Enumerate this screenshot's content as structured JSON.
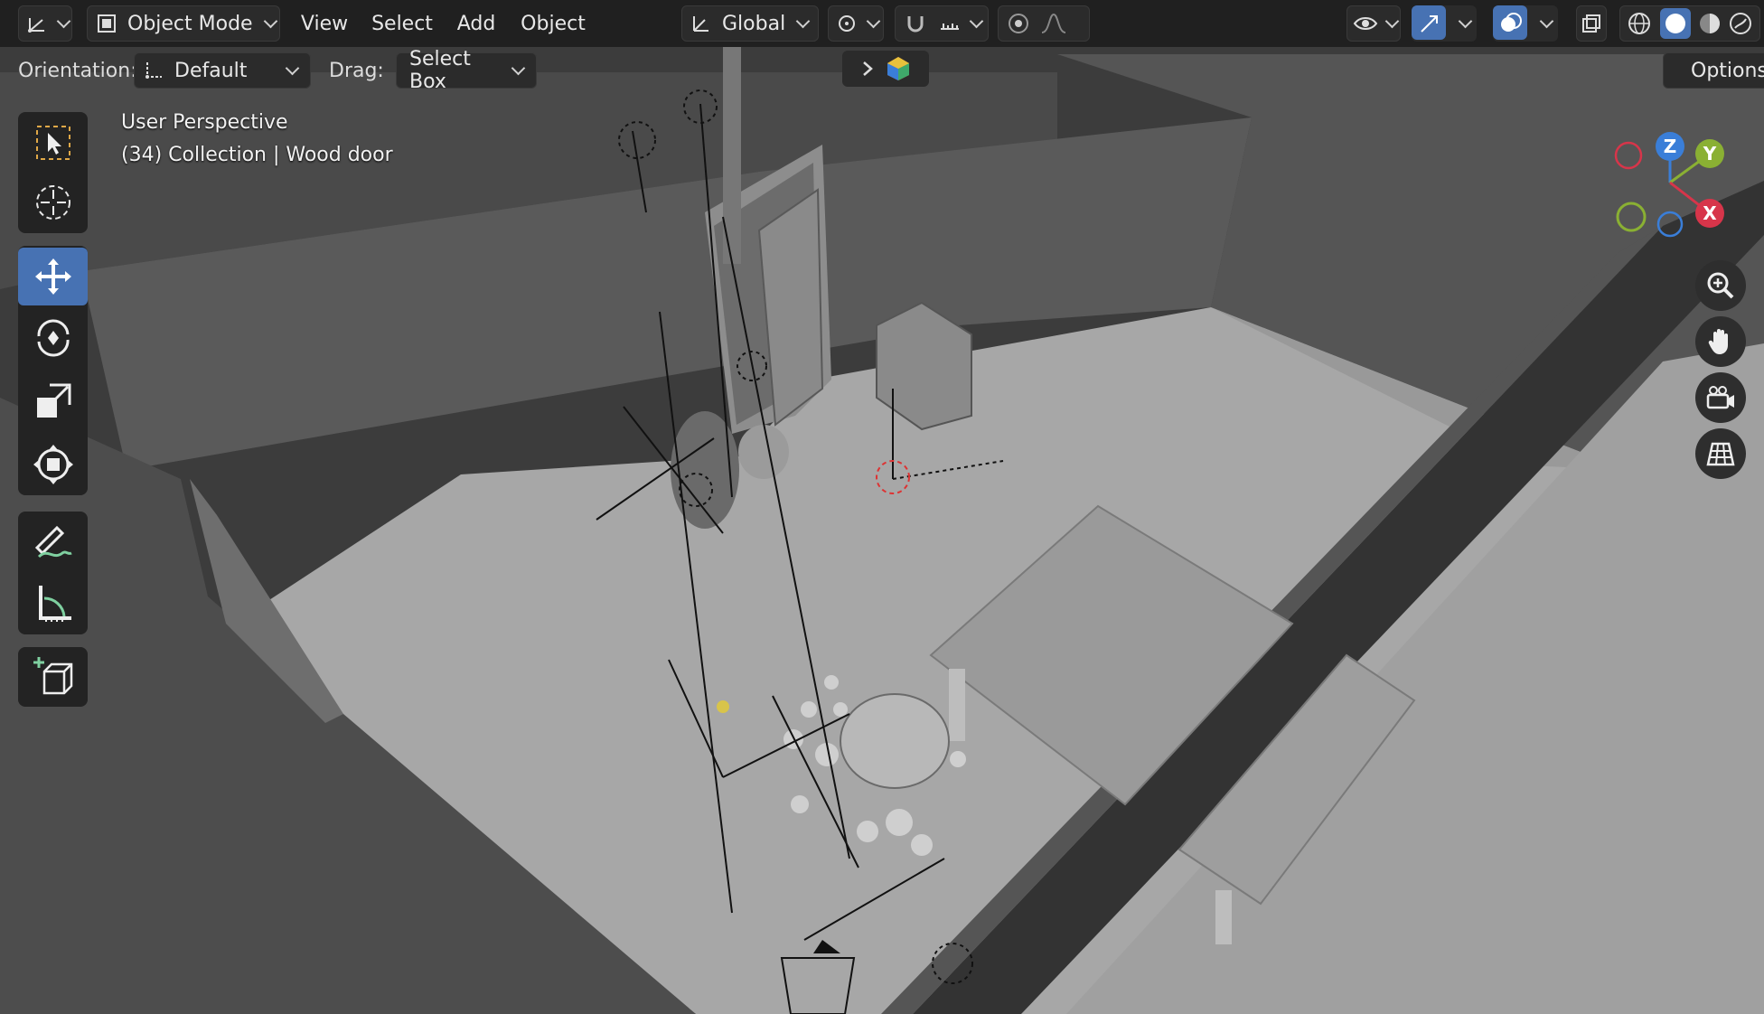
{
  "header": {
    "editor_type_icon": "axes-gizmo-icon",
    "mode": "Object Mode",
    "menus": [
      "View",
      "Select",
      "Add",
      "Object"
    ],
    "transform_orientation": "Global"
  },
  "tool_header": {
    "orientation_label": "Orientation:",
    "orientation_value": "Default",
    "drag_label": "Drag:",
    "drag_value": "Select Box",
    "options_label": "Options"
  },
  "viewport": {
    "perspective": "User Perspective",
    "collection_info": "(34) Collection | Wood door"
  },
  "gizmo": {
    "x": "X",
    "y": "Y",
    "z": "Z",
    "x_color": "#d7354a",
    "y_color": "#8ab033",
    "z_color": "#3a7ed8"
  },
  "colors": {
    "accent": "#4772b3",
    "header_bg": "#1c1c1c",
    "button_bg": "#2b2b2b"
  },
  "toolbar_tools": [
    {
      "name": "select-box-tool",
      "icon": "select-cursor-icon"
    },
    {
      "name": "cursor-tool",
      "icon": "crosshair-cursor-icon"
    },
    {
      "name": "move-tool",
      "icon": "move-arrows-icon",
      "active": true
    },
    {
      "name": "rotate-tool",
      "icon": "rotate-icon"
    },
    {
      "name": "scale-tool",
      "icon": "scale-icon"
    },
    {
      "name": "transform-tool",
      "icon": "transform-icon"
    },
    {
      "name": "annotate-tool",
      "icon": "annotate-pen-icon"
    },
    {
      "name": "measure-tool",
      "icon": "measure-ruler-icon"
    },
    {
      "name": "add-cube-tool",
      "icon": "add-cube-icon"
    }
  ],
  "nav_buttons": [
    "zoom-icon",
    "pan-hand-icon",
    "camera-view-icon",
    "ortho-grid-icon"
  ]
}
